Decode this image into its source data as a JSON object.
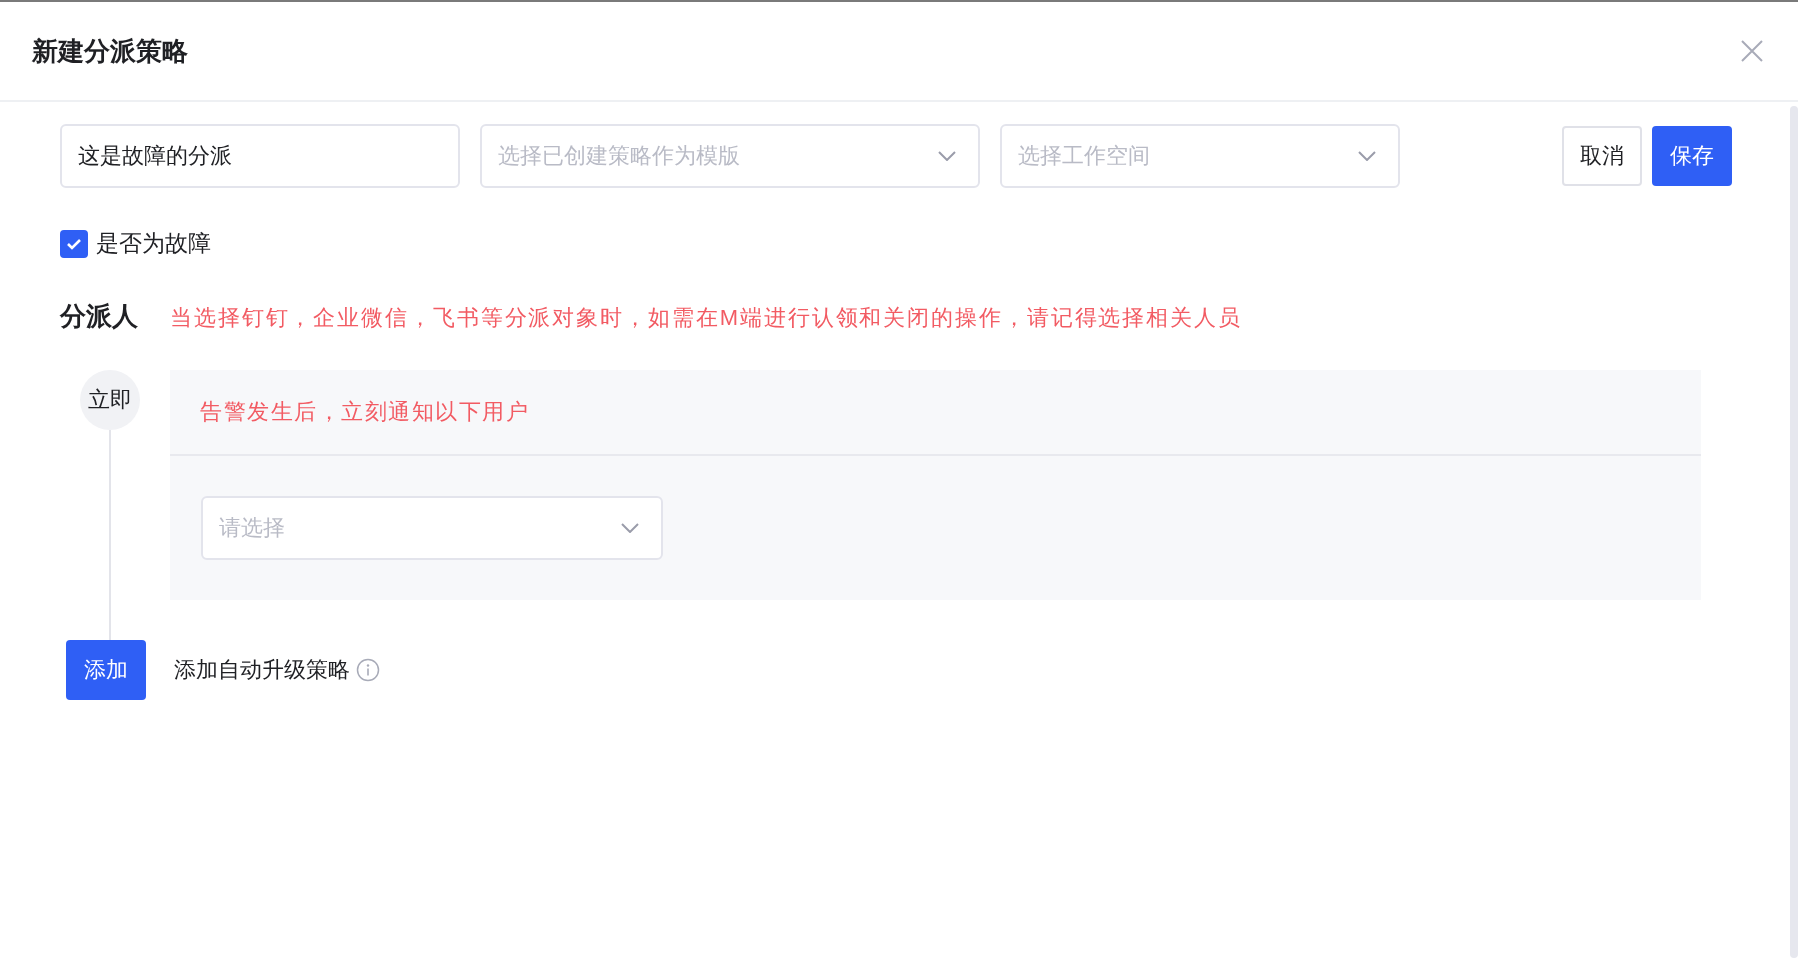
{
  "dialog": {
    "title": "新建分派策略"
  },
  "toolbar": {
    "name_field": {
      "value": "这是故障的分派"
    },
    "template_select": {
      "placeholder": "选择已创建策略作为模版"
    },
    "workspace_select": {
      "placeholder": "选择工作空间"
    },
    "buttons": [
      {
        "label": "取消",
        "kind": "default"
      },
      {
        "label": "保存",
        "kind": "primary"
      }
    ]
  },
  "is_fault": {
    "label": "是否为故障",
    "checked": true
  },
  "assignee": {
    "label": "分派人",
    "hint": "当选择钉钉，企业微信，飞书等分派对象时，如需在M端进行认领和关闭的操作，请记得选择相关人员"
  },
  "steps": [
    {
      "badge": "立即",
      "notice": "告警发生后，立刻通知以下用户",
      "select": {
        "placeholder": "请选择"
      }
    }
  ],
  "add": {
    "button": "添加",
    "label": "添加自动升级策略"
  }
}
